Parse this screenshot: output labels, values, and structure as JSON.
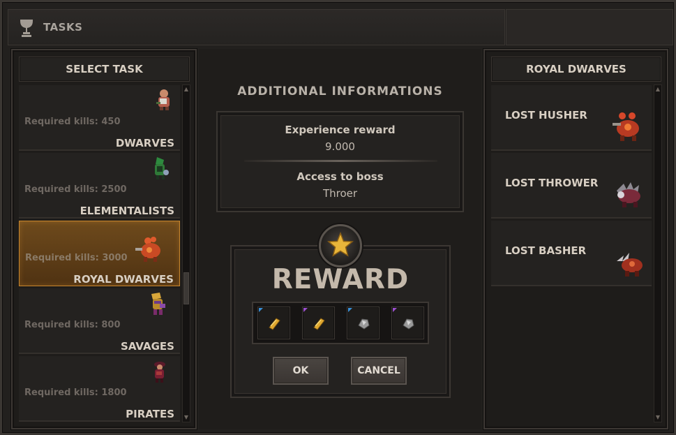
{
  "window": {
    "title": "TASKS",
    "title_icon": "trophy-cup-icon"
  },
  "task_panel": {
    "header": "SELECT TASK",
    "tasks": [
      {
        "kills_label": "Required kills: 450",
        "name": "DWARVES",
        "sprite": "dwarf-sprite-icon"
      },
      {
        "kills_label": "Required kills: 2500",
        "name": "ELEMENTALISTS",
        "sprite": "elementalist-sprite-icon"
      },
      {
        "kills_label": "Required kills: 3000",
        "name": "ROYAL DWARVES",
        "sprite": "royal-dwarf-sprite-icon",
        "selected": true
      },
      {
        "kills_label": "Required kills: 800",
        "name": "SAVAGES",
        "sprite": "savage-sprite-icon"
      },
      {
        "kills_label": "Required kills: 1800",
        "name": "PIRATES",
        "sprite": "pirate-sprite-icon"
      }
    ]
  },
  "info": {
    "heading": "ADDITIONAL INFORMATIONS",
    "experience_label": "Experience reward",
    "experience_value": "9.000",
    "boss_label": "Access to boss",
    "boss_value": "Throer"
  },
  "reward": {
    "title": "REWARD",
    "medal_icon": "star-medal-icon",
    "items": [
      {
        "icon": "gold-ingot-icon",
        "rarity_color": "#3a8fd6"
      },
      {
        "icon": "gold-ingot-icon",
        "rarity_color": "#9b4fd0"
      },
      {
        "icon": "silver-ore-icon",
        "rarity_color": "#3a8fd6"
      },
      {
        "icon": "silver-ore-icon",
        "rarity_color": "#9b4fd0"
      }
    ],
    "ok_label": "OK",
    "cancel_label": "CANCEL"
  },
  "boss_panel": {
    "header": "ROYAL DWARVES",
    "bosses": [
      {
        "name": "LOST HUSHER",
        "sprite": "lost-husher-sprite-icon"
      },
      {
        "name": "LOST THROWER",
        "sprite": "lost-thrower-sprite-icon"
      },
      {
        "name": "LOST BASHER",
        "sprite": "lost-basher-sprite-icon"
      }
    ]
  },
  "colors": {
    "selected_accent": "#c8862c",
    "text_light": "#d8cfc3",
    "text_dim": "#6f6862"
  }
}
